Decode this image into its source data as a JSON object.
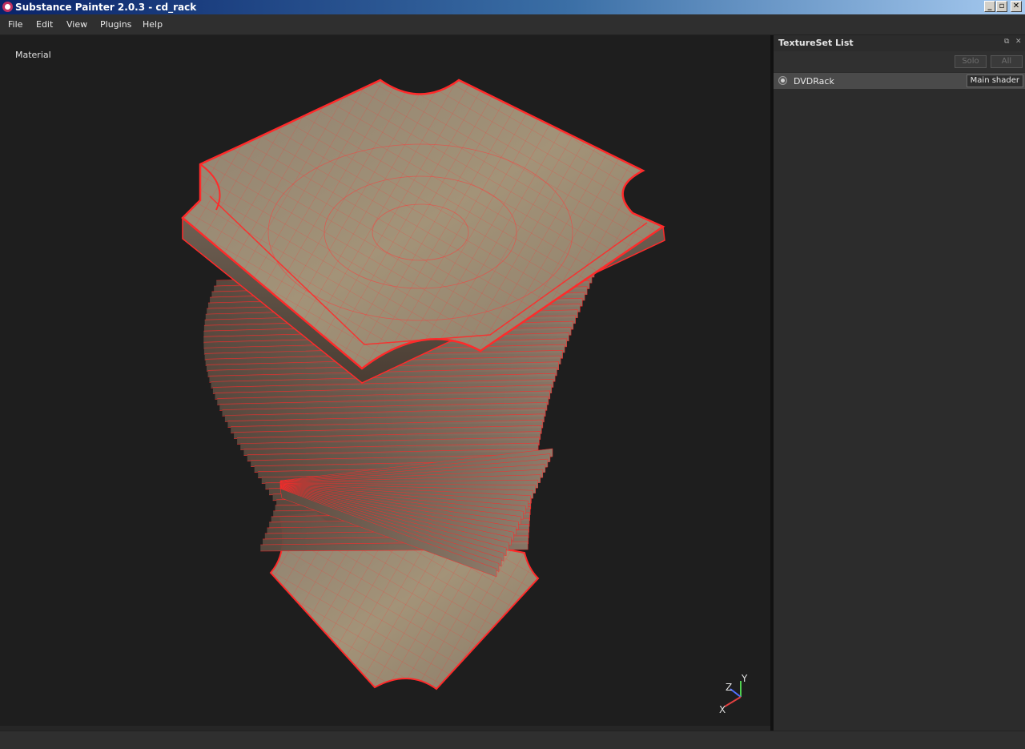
{
  "window": {
    "title": "Substance Painter 2.0.3 - cd_rack",
    "controls": [
      "_",
      "▫",
      "✕"
    ]
  },
  "menu": [
    "File",
    "Edit",
    "View",
    "Plugins",
    "Help"
  ],
  "viewport": {
    "label": "Material",
    "gizmo": {
      "y": "Y",
      "z": "Z",
      "x": "X"
    },
    "wire_color": "#ff2a2a",
    "surface_color": "#9a8a72"
  },
  "texture_panel": {
    "title": "TextureSet List",
    "solo_label": "Solo",
    "all_label": "All",
    "sets": [
      {
        "name": "DVDRack",
        "shader": "Main shader"
      }
    ]
  }
}
